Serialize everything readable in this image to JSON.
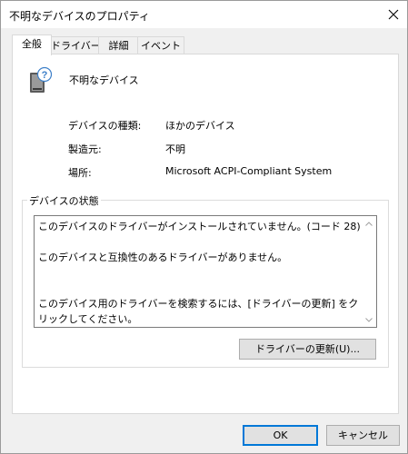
{
  "window": {
    "title": "不明なデバイスのプロパティ"
  },
  "tabs": [
    {
      "label": "全般",
      "active": true
    },
    {
      "label": "ドライバー",
      "active": false
    },
    {
      "label": "詳細",
      "active": false
    },
    {
      "label": "イベント",
      "active": false
    }
  ],
  "device": {
    "name": "不明なデバイス",
    "icon": "unknown-device-icon"
  },
  "properties": [
    {
      "label": "デバイスの種類:",
      "value": "ほかのデバイス"
    },
    {
      "label": "製造元:",
      "value": "不明"
    },
    {
      "label": "場所:",
      "value": "Microsoft ACPI-Compliant System"
    }
  ],
  "status": {
    "group_label": "デバイスの状態",
    "text": "このデバイスのドライバーがインストールされていません。(コード 28)\n\nこのデバイスと互換性のあるドライバーがありません。\n\n\nこのデバイス用のドライバーを検索するには、[ドライバーの更新] をクリックしてください。"
  },
  "buttons": {
    "update_driver": "ドライバーの更新(U)...",
    "ok": "OK",
    "cancel": "キャンセル"
  },
  "colors": {
    "accent": "#0078d7",
    "dialog_bg": "#f0f0f0",
    "panel_bg": "#ffffff",
    "button_bg": "#e1e1e1"
  }
}
